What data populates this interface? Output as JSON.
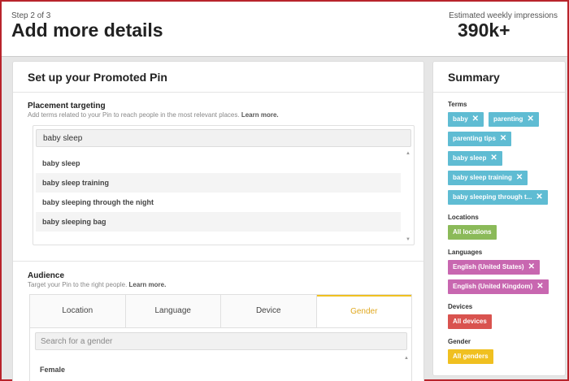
{
  "header": {
    "step": "Step 2 of 3",
    "title": "Add more details",
    "impressions_label": "Estimated weekly impressions",
    "impressions_value": "390k+"
  },
  "main": {
    "title": "Set up your Promoted Pin",
    "placement": {
      "title": "Placement targeting",
      "desc": "Add terms related to your Pin to reach people in the most relevant places.",
      "learn_more": "Learn more.",
      "input_value": "baby sleep",
      "suggestions": [
        "baby sleep",
        "baby sleep training",
        "baby sleeping through the night",
        "baby sleeping bag"
      ]
    },
    "audience": {
      "title": "Audience",
      "desc": "Target your Pin to the right people.",
      "learn_more": "Learn more.",
      "tabs": [
        "Location",
        "Language",
        "Device",
        "Gender"
      ],
      "active_tab": "Gender",
      "search_placeholder": "Search for a gender",
      "options": [
        "Female"
      ]
    }
  },
  "summary": {
    "title": "Summary",
    "terms_label": "Terms",
    "terms": [
      "baby",
      "parenting",
      "parenting tips",
      "baby sleep",
      "baby sleep training",
      "baby sleeping through t..."
    ],
    "locations_label": "Locations",
    "locations": [
      "All locations"
    ],
    "languages_label": "Languages",
    "languages": [
      "English (United States)",
      "English (United Kingdom)"
    ],
    "devices_label": "Devices",
    "devices": [
      "All devices"
    ],
    "gender_label": "Gender",
    "gender": [
      "All genders"
    ],
    "remove_icon": "✕"
  },
  "colors": {
    "term_chip": "#5fbcd3",
    "location_chip": "#8bba59",
    "language_chip": "#c867b0",
    "device_chip": "#d9534f",
    "gender_chip": "#f0c020",
    "active_tab": "#e0a81f"
  }
}
